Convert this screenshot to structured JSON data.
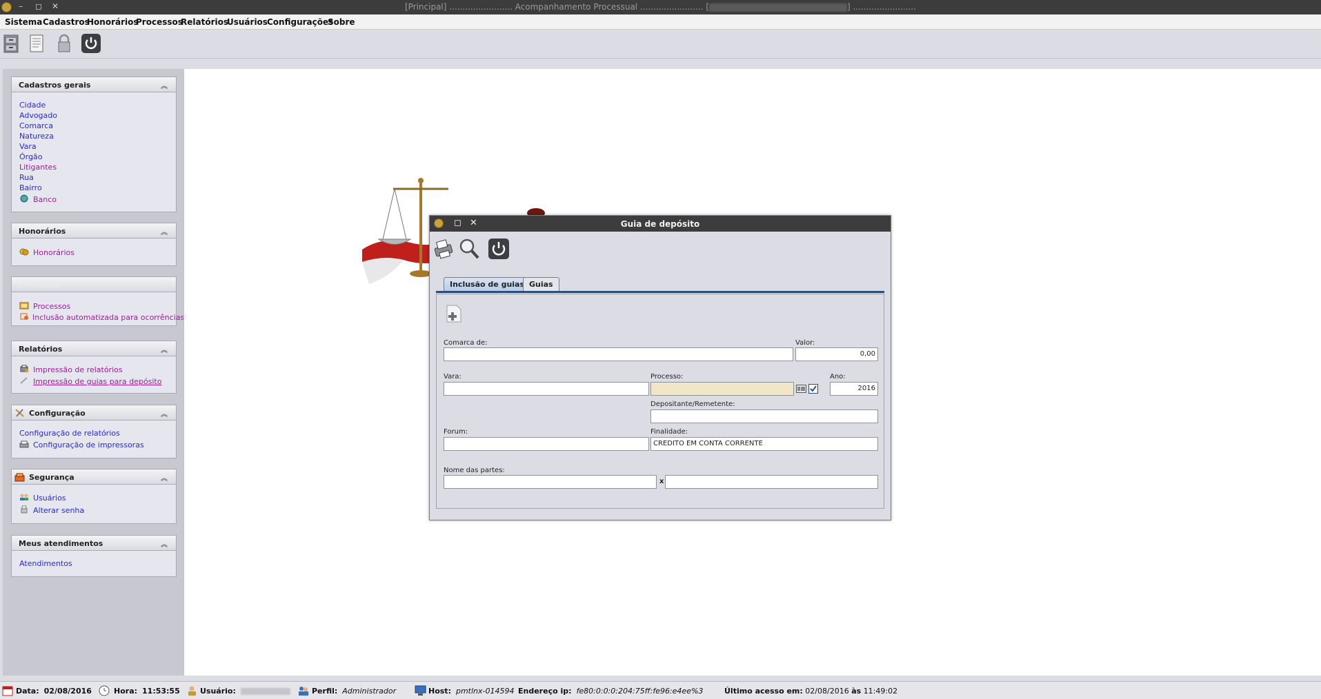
{
  "window": {
    "title_left": "[Principal] ........................ Acompanhamento Processual ........................ [",
    "title_right": "] ........................",
    "minimize": "–",
    "maximize": "◻",
    "close": "✕"
  },
  "menu": [
    "Sistema",
    "Cadastros",
    "Honorários",
    "Processos",
    "Relatórios",
    "Usuários",
    "Configurações",
    "Sobre"
  ],
  "toolbar": {
    "icons": [
      "cabinet-icon",
      "document-icon",
      "lock-icon",
      "power-icon"
    ]
  },
  "sidebar": {
    "cadastros": {
      "title": "Cadastros gerais",
      "items": [
        "Cidade",
        "Advogado",
        "Comarca",
        "Natureza",
        "Vara",
        "Órgão",
        "Litigantes",
        "Rua",
        "Bairro",
        "Banco"
      ]
    },
    "honorarios": {
      "title": "Honorários",
      "items": [
        "Honorários"
      ]
    },
    "processos": {
      "title": "Processos",
      "items": [
        "Processos",
        "Inclusão automatizada para ocorrências"
      ]
    },
    "relatorios": {
      "title": "Relatórios",
      "items": [
        "Impressão de relatórios",
        "Impressão de guias para depósito"
      ]
    },
    "configuracao": {
      "title": "Configuração",
      "items": [
        "Configuração de relatórios",
        "Configuração de impressoras"
      ]
    },
    "seguranca": {
      "title": "Segurança",
      "items": [
        "Usuários",
        "Alterar senha"
      ]
    },
    "atendimentos": {
      "title": "Meus atendimentos",
      "items": [
        "Atendimentos"
      ]
    },
    "chevron": "︽"
  },
  "dialog": {
    "title": "Guia de depósito",
    "tabs": [
      "Inclusão de guias",
      "Guias"
    ],
    "labels": {
      "comarca": "Comarca de:",
      "valor": "Valor:",
      "vara": "Vara:",
      "processo": "Processo:",
      "ano": "Ano:",
      "depositante": "Depositante/Remetente:",
      "forum": "Forum:",
      "finalidade": "Finalidade:",
      "nome_partes": "Nome das partes:",
      "x": "x"
    },
    "values": {
      "comarca": "",
      "valor": "0,00",
      "vara": "",
      "processo": "",
      "ano": "2016",
      "depositante": "",
      "forum": "",
      "finalidade": "CREDITO EM CONTA CORRENTE",
      "parte1": "",
      "parte2": ""
    }
  },
  "status": {
    "data_label": "Data:",
    "data": "02/08/2016",
    "hora_label": "Hora:",
    "hora": "11:53:55",
    "usuario_label": "Usuário:",
    "perfil_label": "Perfil:",
    "perfil": "Administrador",
    "host_label": "Host:",
    "host": "pmtlnx-014594",
    "ip_label": "Endereço ip:",
    "ip": "fe80:0:0:0:204:75ff:fe96:e4ee%3",
    "ultimo_label": "Último acesso em:",
    "ultimo_data": "02/08/2016",
    "as": "às",
    "ultimo_hora": "11:49:02"
  }
}
